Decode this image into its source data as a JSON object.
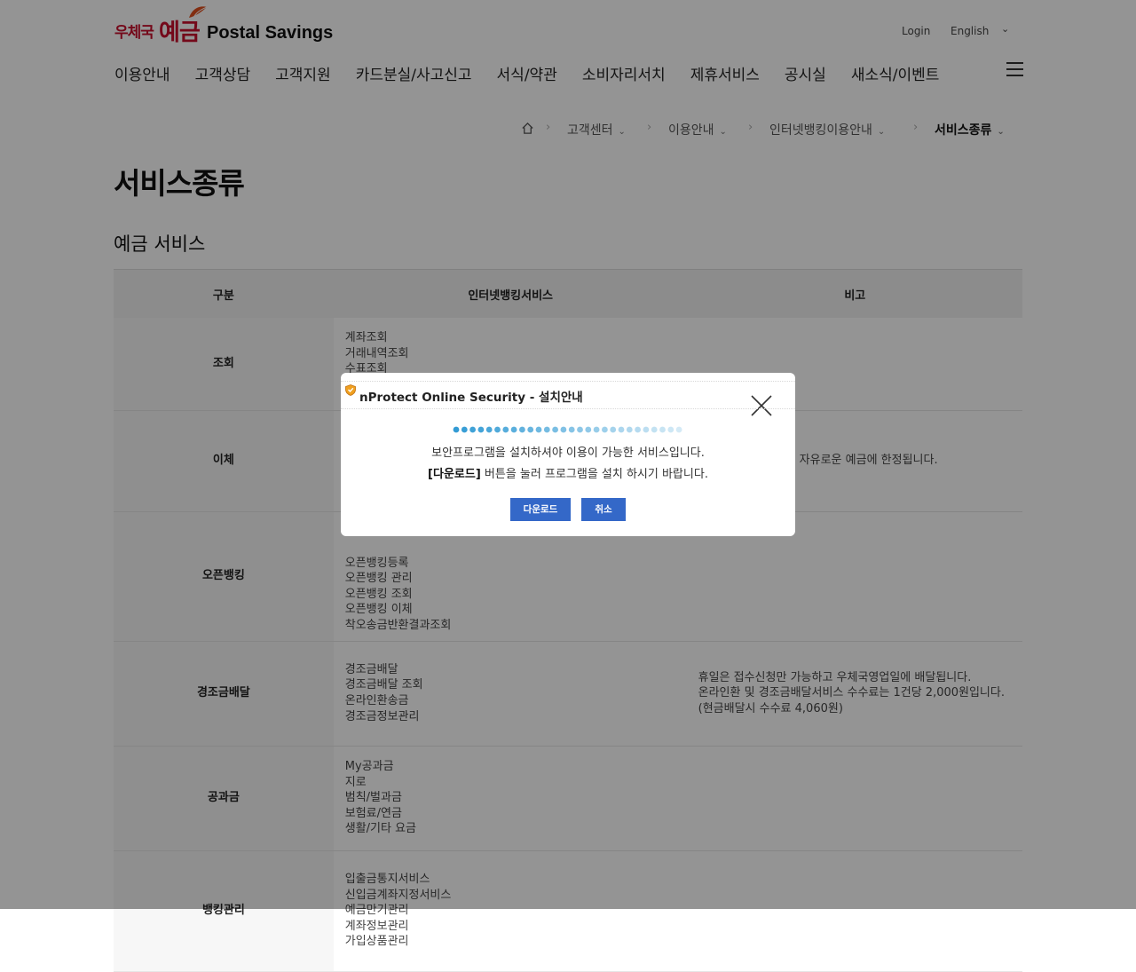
{
  "header": {
    "logo_ko_small": "우체국",
    "logo_ko_large": "예금",
    "logo_en": "Postal Savings",
    "login_label": "Login",
    "language_label": "English",
    "gnb": [
      "이용안내",
      "고객상담",
      "고객지원",
      "카드분실/사고신고",
      "서식/약관",
      "소비자리서치",
      "제휴서비스",
      "공시실",
      "새소식/이벤트"
    ]
  },
  "breadcrumb": {
    "items": [
      "고객센터",
      "이용안내",
      "인터넷뱅킹이용안내",
      "서비스종류"
    ]
  },
  "page_title": "서비스종류",
  "section_title": "예금 서비스",
  "table": {
    "headers": [
      "구분",
      "인터넷뱅킹서비스",
      "비고"
    ],
    "rows": [
      {
        "category": "조회",
        "services": [
          "계좌조회",
          "거래내역조회",
          "수표조회"
        ],
        "note": []
      },
      {
        "category": "이체",
        "services": [],
        "note": [
          "금이 자유로운 예금에 한정됩니다."
        ]
      },
      {
        "category": "오픈뱅킹",
        "services": [
          "오픈뱅킹등록",
          "오픈뱅킹 관리",
          "오픈뱅킹 조회",
          "오픈뱅킹 이체",
          "착오송금반환결과조회"
        ],
        "note": []
      },
      {
        "category": "경조금배달",
        "services": [
          "경조금배달",
          "경조금배달 조회",
          "온라인환송금",
          "경조금정보관리"
        ],
        "note": [
          "휴일은 접수신청만 가능하고 우체국영업일에 배달됩니다.",
          "온라인환 및 경조금배달서비스 수수료는 1건당 2,000원입니다.",
          "(현금배달시 수수료 4,060원)"
        ]
      },
      {
        "category": "공과금",
        "services": [
          "My공과금",
          "지로",
          "범칙/벌과금",
          "보험료/연금",
          "생활/기타 요금"
        ],
        "note": []
      },
      {
        "category": "뱅킹관리",
        "services": [
          "입출금통지서비스",
          "신입금계좌지정서비스",
          "예금만기관리",
          "계좌정보관리",
          "가입상품관리"
        ],
        "note": []
      }
    ]
  },
  "modal": {
    "title": "nProtect Online Security - 설치안내",
    "line1": "보안프로그램을 설치하셔야 이용이 가능한 서비스입니다.",
    "line2_bold": "[다운로드]",
    "line2_rest": " 버튼을 눌러 프로그램을 설치 하시기 바랍니다.",
    "download_label": "다운로드",
    "cancel_label": "취소",
    "icons": [
      "shield-icon",
      "close-icon"
    ]
  },
  "colors": {
    "brand_red": "#c8102e",
    "button_blue": "#3468c8",
    "overlay": "rgba(0,0,0,0.42)"
  }
}
